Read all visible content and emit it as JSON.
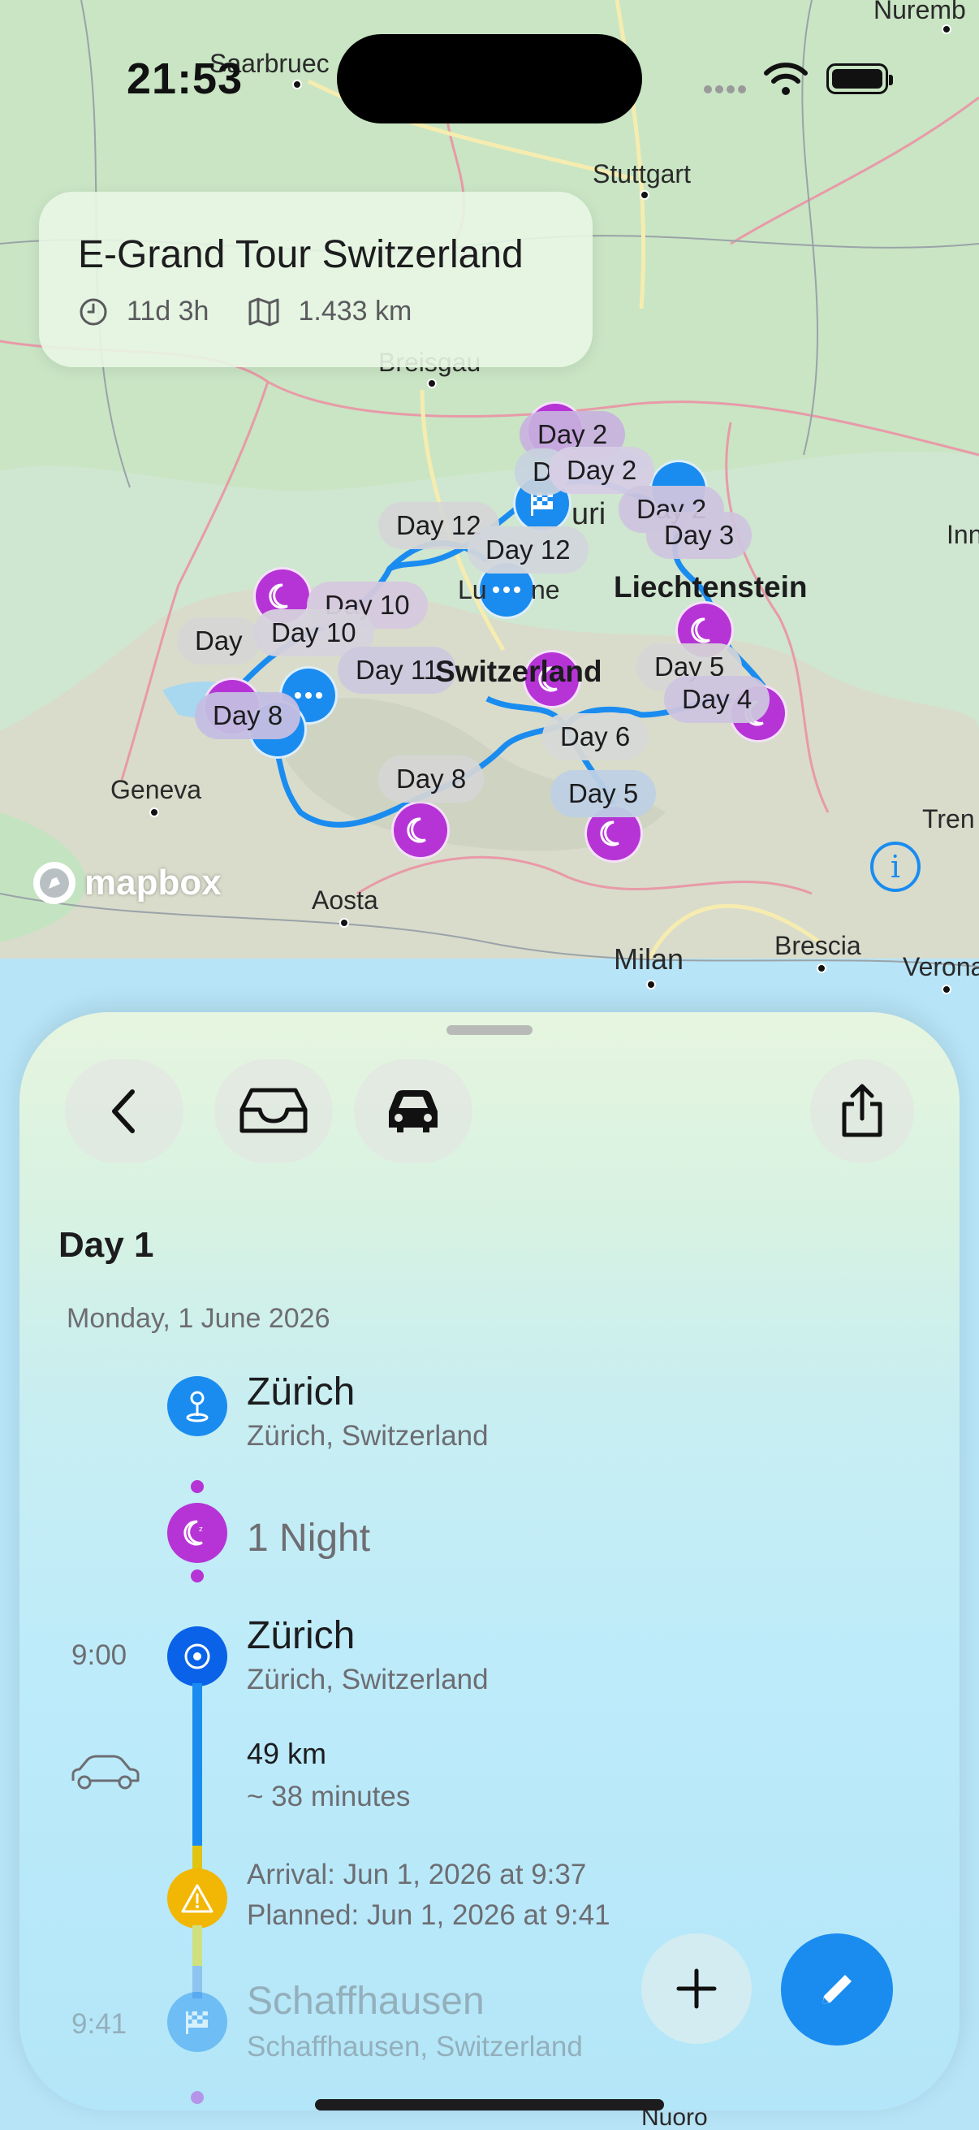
{
  "status_bar": {
    "time": "21:53"
  },
  "trip": {
    "title": "E-Grand Tour Switzerland",
    "duration": "11d 3h",
    "distance": "1.433 km"
  },
  "map": {
    "cities": [
      "Saarbruec",
      "Stuttgart",
      "Breisgau",
      "Nuremb",
      "Geneva",
      "Aosta",
      "Milan",
      "Brescia",
      "Verona",
      "Tren",
      "Inn",
      "Nuoro"
    ],
    "countries": [
      "Liechtenstein",
      "Switzerland"
    ],
    "attribution": "mapbox",
    "day_labels": [
      "Day 2",
      "Day 2",
      "Day 2",
      "Day 3",
      "Day 12",
      "Day 12",
      "Day 10",
      "Day 10",
      "Day 11",
      "Day 8",
      "Day 8",
      "Day 5",
      "Day 4",
      "Day 6",
      "Day 5"
    ],
    "partial_labels": {
      "zurich": "uri",
      "lucerne": "Lu",
      "lucerne_end": "ne",
      "day_cut": "Day",
      "letter": "D"
    }
  },
  "toolbar": {
    "back": "back",
    "inbox": "inbox",
    "car": "car",
    "share": "share"
  },
  "day": {
    "title": "Day 1",
    "date": "Monday, 1 June 2026",
    "stops": [
      {
        "title": "Zürich",
        "subtitle": "Zürich, Switzerland"
      },
      {
        "title": "1 Night"
      },
      {
        "time": "9:00",
        "title": "Zürich",
        "subtitle": "Zürich, Switzerland"
      }
    ],
    "drive": {
      "distance": "49 km",
      "duration": "~ 38 minutes"
    },
    "warning": {
      "arrival": "Arrival: Jun 1, 2026 at 9:37",
      "planned": "Planned: Jun 1, 2026 at 9:41"
    },
    "next_stop": {
      "time": "9:41",
      "title": "Schaffhausen",
      "subtitle": "Schaffhausen, Switzerland"
    }
  },
  "colors": {
    "accent": "#1a8cf0",
    "night": "#b634d6",
    "warning": "#f2b705"
  }
}
